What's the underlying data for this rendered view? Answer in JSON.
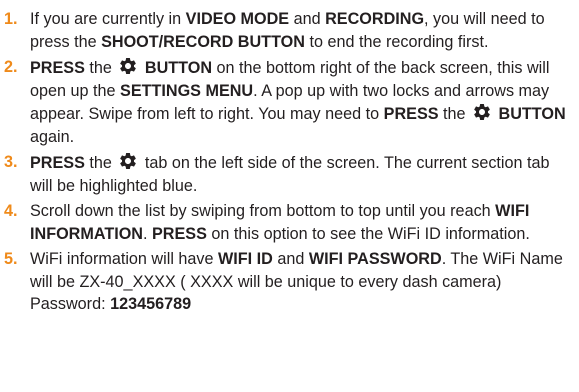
{
  "steps": [
    {
      "number": "1.",
      "parts": [
        {
          "t": "If you are currently in "
        },
        {
          "t": "VIDEO MODE",
          "b": true
        },
        {
          "t": " and "
        },
        {
          "t": "RECORDING",
          "b": true
        },
        {
          "t": ", you will need to press the "
        },
        {
          "t": "SHOOT/RECORD BUTTON",
          "b": true
        },
        {
          "t": " to end the recording first."
        }
      ]
    },
    {
      "number": "2.",
      "parts": [
        {
          "t": "PRESS",
          "b": true
        },
        {
          "t": " the "
        },
        {
          "icon": "gear-icon"
        },
        {
          "t": " BUTTON",
          "b": true
        },
        {
          "t": " on the bottom right of the back screen, this will open up the "
        },
        {
          "t": "SETTINGS MENU",
          "b": true
        },
        {
          "t": ". A pop up with two locks and arrows may appear. Swipe from left to right. You may need to "
        },
        {
          "t": "PRESS",
          "b": true
        },
        {
          "t": " the "
        },
        {
          "icon": "gear-icon"
        },
        {
          "t": " BUTTON",
          "b": true
        },
        {
          "t": " again."
        }
      ]
    },
    {
      "number": "3.",
      "parts": [
        {
          "t": "PRESS",
          "b": true
        },
        {
          "t": " the "
        },
        {
          "icon": "gear-icon"
        },
        {
          "t": " tab on the left side of the screen. The current section tab will be highlighted blue."
        }
      ]
    },
    {
      "number": "4.",
      "parts": [
        {
          "t": "Scroll down the list by swiping from bottom to top until you reach "
        },
        {
          "t": "WIFI INFORMATION",
          "b": true
        },
        {
          "t": ". "
        },
        {
          "t": "PRESS",
          "b": true
        },
        {
          "t": " on this option to see the WiFi ID information."
        }
      ]
    },
    {
      "number": "5.",
      "parts": [
        {
          "t": "WiFi information will have "
        },
        {
          "t": "WIFI ID",
          "b": true
        },
        {
          "t": " and "
        },
        {
          "t": "WIFI PASSWORD",
          "b": true
        },
        {
          "t": ". The WiFi Name will be ZX-40_XXXX ( XXXX will be unique to every dash camera) Password: "
        },
        {
          "t": "123456789",
          "b": true
        }
      ]
    }
  ],
  "colors": {
    "number": "#ef8a1a",
    "text": "#231f20"
  }
}
